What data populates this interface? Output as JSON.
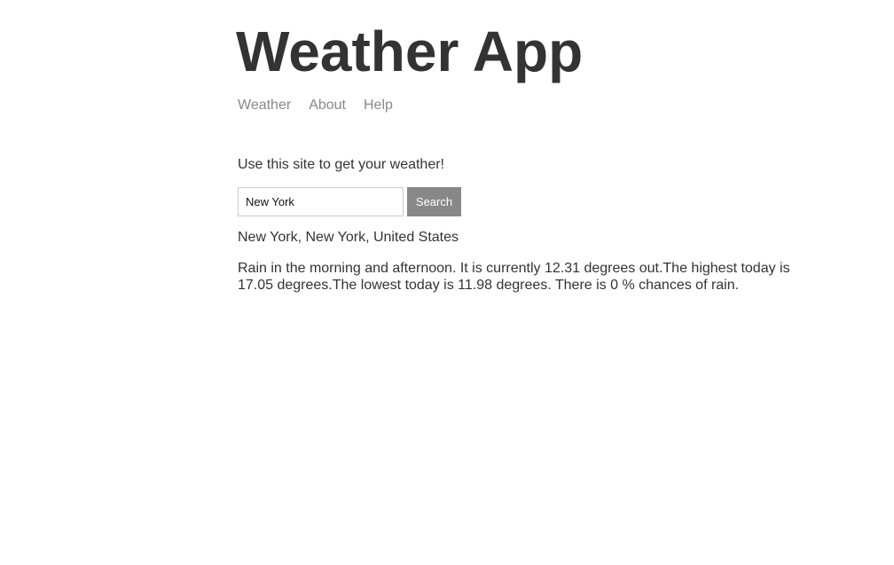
{
  "header": {
    "title": "Weather App"
  },
  "nav": {
    "items": [
      {
        "label": "Weather"
      },
      {
        "label": "About"
      },
      {
        "label": "Help"
      }
    ]
  },
  "main": {
    "intro": "Use this site to get your weather!",
    "search": {
      "value": "New York",
      "placeholder": "",
      "button_label": "Search"
    },
    "location": "New York, New York, United States",
    "forecast": "Rain in the morning and afternoon. It is currently 12.31 degrees out.The highest today is 17.05 degrees.The lowest today is 11.98 degrees. There is 0 % chances of rain."
  },
  "colors": {
    "text": "#333333",
    "nav_link": "#888888",
    "button_bg": "#888888",
    "button_text": "#ffffff",
    "input_border": "#cccccc"
  }
}
